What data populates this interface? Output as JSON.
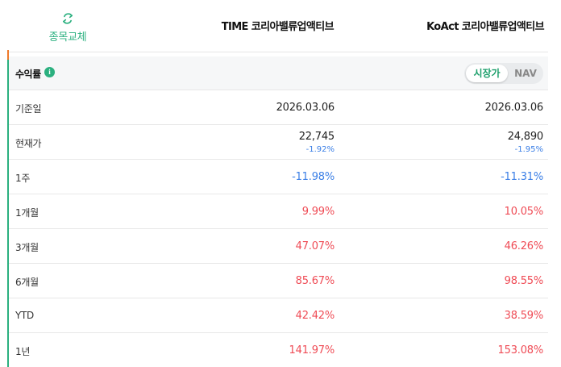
{
  "header": {
    "swap_label": "종목교체",
    "columns": [
      "TIME 코리아밸류업액티브",
      "KoAct 코리아밸류업액티브"
    ]
  },
  "section": {
    "title": "수익률",
    "info_symbol": "i",
    "toggle": {
      "selected": "시장가",
      "other": "NAV"
    }
  },
  "rows": [
    {
      "label": "기준일",
      "a": "2026.03.06",
      "b": "2026.03.06"
    },
    {
      "label": "현재가",
      "a": "22,745",
      "a_sub": "-1.92%",
      "b": "24,890",
      "b_sub": "-1.95%"
    },
    {
      "label": "1주",
      "a": "-11.98%",
      "b": "-11.31%"
    },
    {
      "label": "1개월",
      "a": "9.99%",
      "b": "10.05%"
    },
    {
      "label": "3개월",
      "a": "47.07%",
      "b": "46.26%"
    },
    {
      "label": "6개월",
      "a": "85.67%",
      "b": "98.55%"
    },
    {
      "label": "YTD",
      "a": "42.42%",
      "b": "38.59%"
    },
    {
      "label": "1년",
      "a": "141.97%",
      "b": "153.08%"
    }
  ],
  "colors": {
    "accent": "#2bb07f",
    "positive": "#ef4b55",
    "negative": "#3b7fe6",
    "marker": "#f07a2a"
  }
}
